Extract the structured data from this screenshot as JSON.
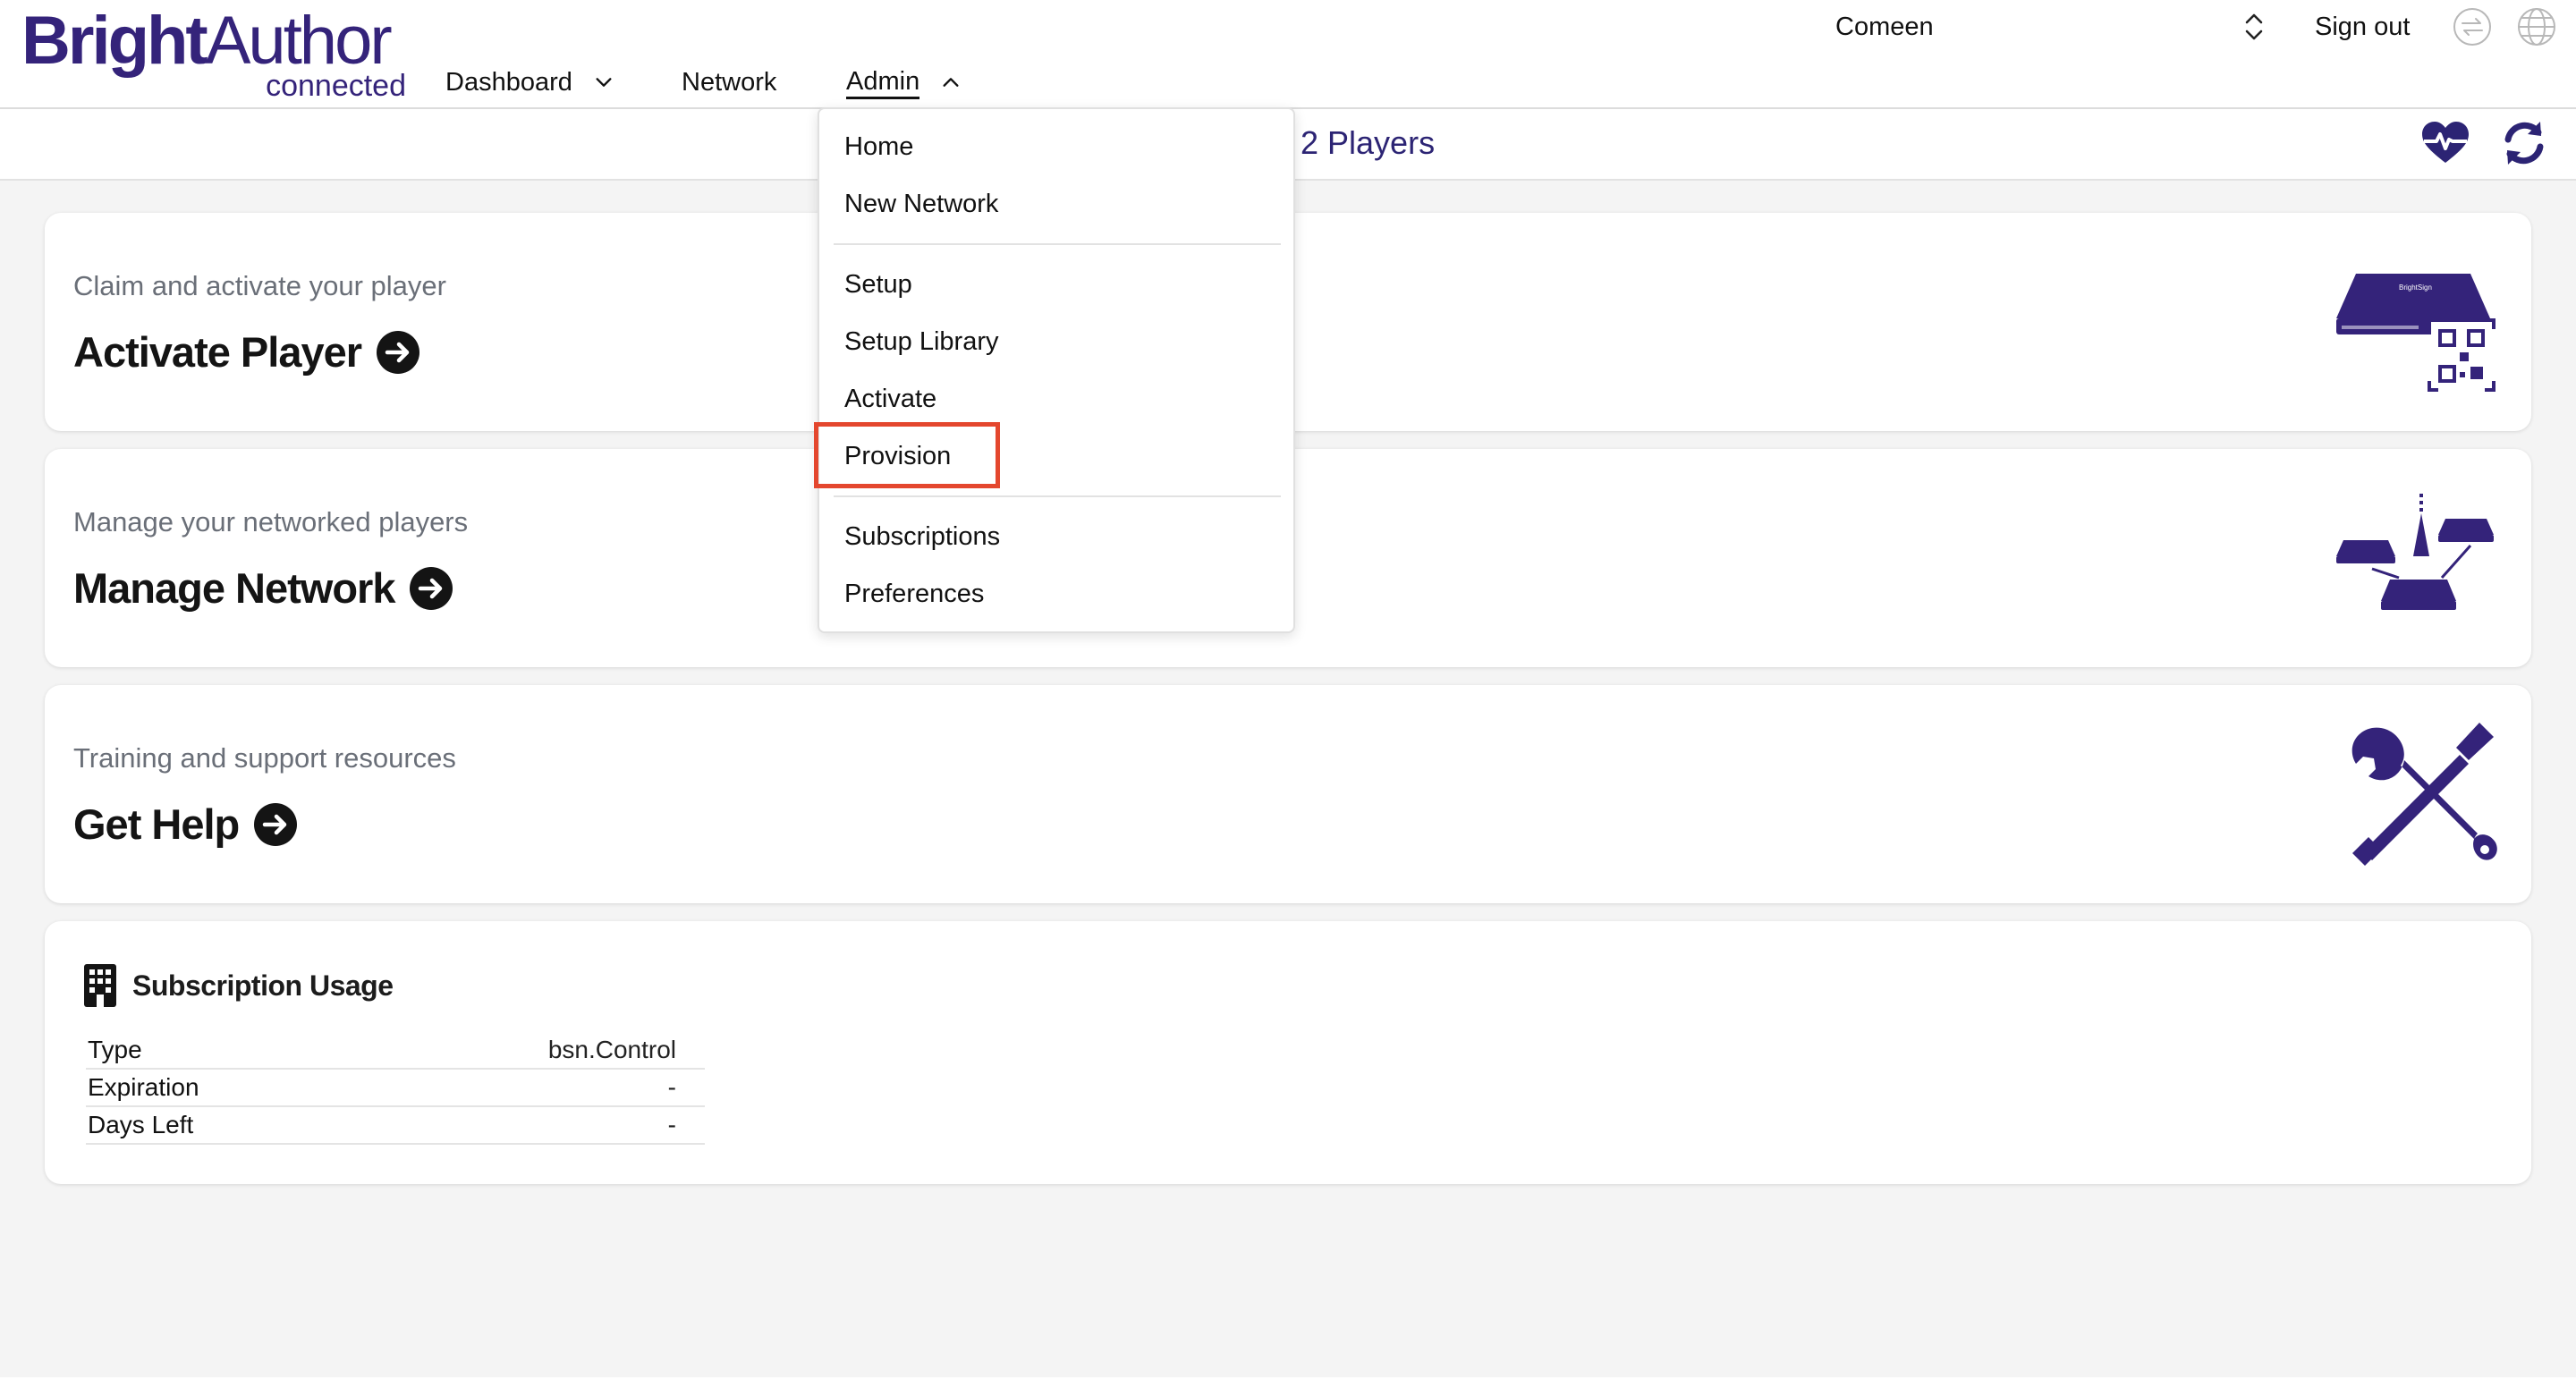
{
  "brand": {
    "name_bold": "Bright",
    "name_light": "Author",
    "sub": "connected",
    "color": "#34237a"
  },
  "nav": [
    {
      "label": "Dashboard",
      "has_chevron": true,
      "chevron": "down"
    },
    {
      "label": "Network",
      "has_chevron": false
    },
    {
      "label": "Admin",
      "has_chevron": true,
      "chevron": "up",
      "active": true
    }
  ],
  "account": {
    "name": "Comeen",
    "sign_out": "Sign out"
  },
  "header_icons": [
    "switch-icon",
    "globe-icon"
  ],
  "subbar": {
    "players_text": "2 Players",
    "icons": [
      "heartbeat-icon",
      "refresh-icon"
    ]
  },
  "cards": [
    {
      "subtitle": "Claim and activate your player",
      "title": "Activate Player",
      "art": "player-qr-illustration"
    },
    {
      "subtitle": "Manage your networked players",
      "title": "Manage Network",
      "art": "network-players-illustration"
    },
    {
      "subtitle": "Training and support resources",
      "title": "Get Help",
      "art": "tools-illustration"
    }
  ],
  "subscription": {
    "title": "Subscription Usage",
    "rows": [
      {
        "key": "Type",
        "value": "bsn.Control"
      },
      {
        "key": "Expiration",
        "value": "-"
      },
      {
        "key": "Days Left",
        "value": "-"
      }
    ]
  },
  "admin_menu": {
    "groups": [
      [
        "Home",
        "New Network"
      ],
      [
        "Setup",
        "Setup Library",
        "Activate",
        "Provision"
      ],
      [
        "Subscriptions",
        "Preferences"
      ]
    ],
    "highlighted": "Provision",
    "highlight_color": "#e4472e"
  },
  "colors": {
    "accent": "#2c2474",
    "page_bg": "#f4f4f4"
  }
}
